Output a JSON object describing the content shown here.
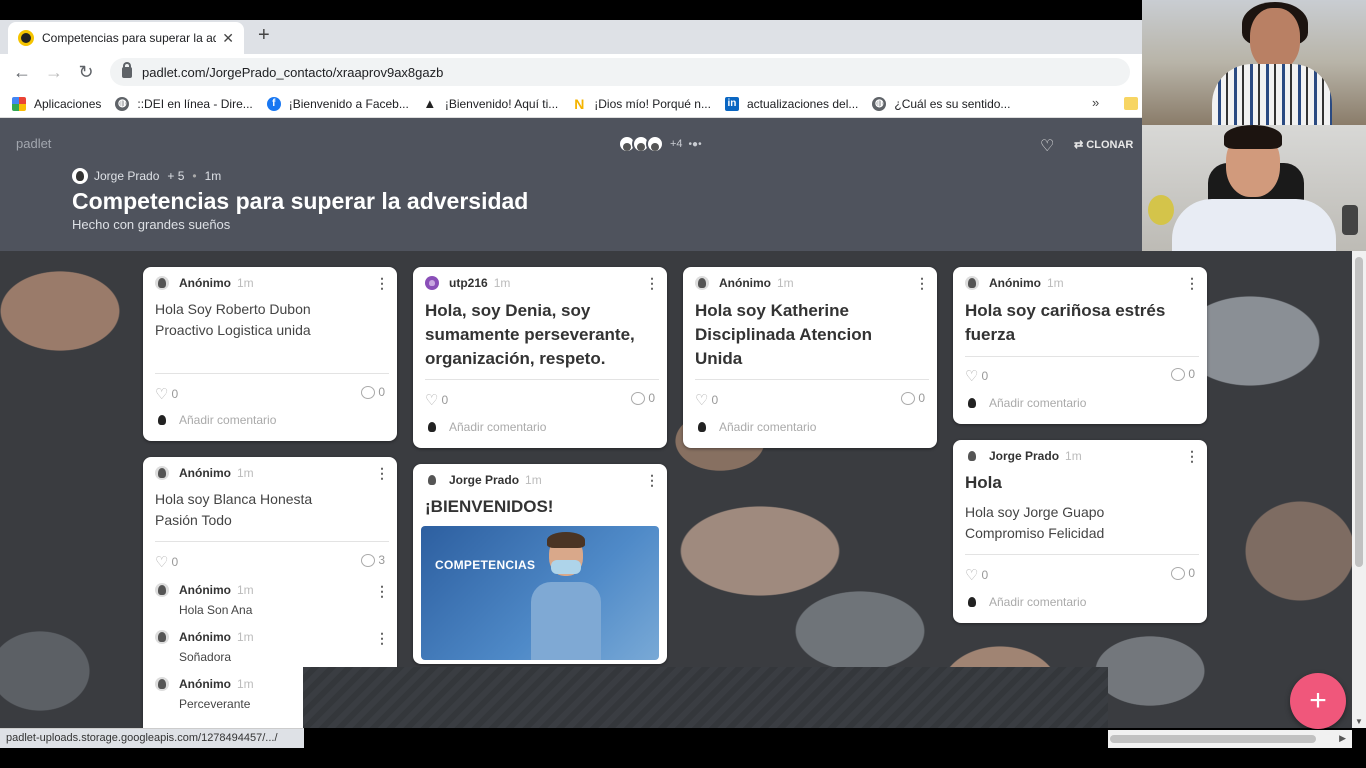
{
  "browser": {
    "tab_title": "Competencias para superar la ad",
    "url": "padlet.com/JorgePrado_contacto/xraaprov9ax8gazb",
    "bookmarks": [
      {
        "label": "Aplicaciones",
        "icon": "apps-grid-icon"
      },
      {
        "label": "::DEI en línea - Dire...",
        "icon": "globe-icon"
      },
      {
        "label": "¡Bienvenido a Faceb...",
        "icon": "facebook-icon"
      },
      {
        "label": "¡Bienvenido! Aquí ti...",
        "icon": "triangle-logo-icon"
      },
      {
        "label": "¡Dios mío! Porqué n...",
        "icon": "n-logo-icon"
      },
      {
        "label": "actualizaciones del...",
        "icon": "linkedin-icon"
      },
      {
        "label": "¿Cuál es su sentido...",
        "icon": "globe-icon"
      }
    ],
    "overflow": "»",
    "status_url": "padlet-uploads.storage.googleapis.com/1278494457/.../"
  },
  "padlet": {
    "logo": "padlet",
    "collaborator_extra": "+4",
    "clone_label": "CLONAR",
    "author": "Jorge Prado",
    "author_extra": "+ 5",
    "age": "1m",
    "title": "Competencias para superar la adversidad",
    "subtitle": "Hecho con grandes sueños",
    "add_symbol": "+"
  },
  "posts": [
    {
      "author": "Anónimo",
      "time": "1m",
      "body": "Hola Soy Roberto Dubon Proactivo Logistica unida",
      "likes": "0",
      "comments": "0",
      "add_comment": "Añadir comentario"
    },
    {
      "author": "utp216",
      "time": "1m",
      "title": "Hola, soy Denia, soy sumamente perseverante, organización, respeto.",
      "likes": "0",
      "comments": "0",
      "add_comment": "Añadir comentario"
    },
    {
      "author": "Anónimo",
      "time": "1m",
      "title": "Hola soy Katherine Disciplinada Atencion Unida",
      "likes": "0",
      "comments": "0",
      "add_comment": "Añadir comentario"
    },
    {
      "author": "Anónimo",
      "time": "1m",
      "title": "Hola soy cariñosa estrés fuerza",
      "likes": "0",
      "comments": "0",
      "add_comment": "Añadir comentario"
    },
    {
      "author": "Anónimo",
      "time": "1m",
      "body": "Hola soy Blanca Honesta Pasión Todo",
      "likes": "0",
      "comments": "3",
      "replies": [
        {
          "author": "Anónimo",
          "time": "1m",
          "text": "Hola Son Ana"
        },
        {
          "author": "Anónimo",
          "time": "1m",
          "text": "Soñadora"
        },
        {
          "author": "Anónimo",
          "time": "1m",
          "text": "Perceverante"
        }
      ]
    },
    {
      "author": "Jorge Prado",
      "time": "1m",
      "title": "¡BIENVENIDOS!",
      "image_caption": "COMPETENCIAS"
    },
    {
      "author": "Jorge Prado",
      "time": "1m",
      "title": "Hola",
      "body": "Hola soy Jorge Guapo Compromiso Felicidad",
      "likes": "0",
      "comments": "0",
      "add_comment": "Añadir comentario"
    }
  ],
  "colors": {
    "header_bg": "#4f535d",
    "fab": "#f0577b"
  }
}
